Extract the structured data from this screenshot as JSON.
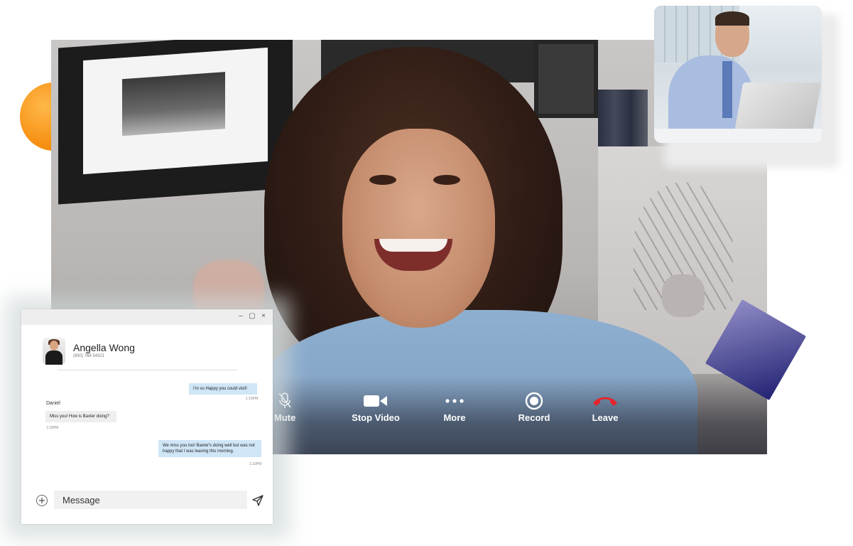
{
  "call": {
    "controls": {
      "mute": "Mute",
      "stop_video": "Stop Video",
      "more": "More",
      "record": "Record",
      "leave": "Leave"
    },
    "icons": {
      "mute": "mic-off-icon",
      "stop_video": "video-camera-icon",
      "more": "more-dots-icon",
      "record": "record-icon",
      "leave": "hang-up-icon"
    },
    "colors": {
      "leave": "#e3262b",
      "controls_text": "#ffffff"
    }
  },
  "chat": {
    "window_buttons": [
      "–",
      "▢",
      "×"
    ],
    "contact": {
      "name": "Angella Wong",
      "phone": "(650) 768 54321"
    },
    "messages": [
      {
        "direction": "out",
        "text": "I'm so Happy you could visit!",
        "time": "1:15PM"
      },
      {
        "direction": "in",
        "sender": "Daniel",
        "text": "Miss you! How is Baxter doing?",
        "time": "1:18PM"
      },
      {
        "direction": "out",
        "text": "We miss you too! Baxter's doing well but was not happy that I was leaving this morning.",
        "time": "1:32PM"
      }
    ],
    "input": {
      "placeholder": "Message"
    },
    "colors": {
      "outgoing_bubble": "#cfe6f7",
      "incoming_bubble": "#eeeeee"
    }
  },
  "decorations": {
    "circle_color": "#f58a0a",
    "diamond_color": "#232373"
  }
}
